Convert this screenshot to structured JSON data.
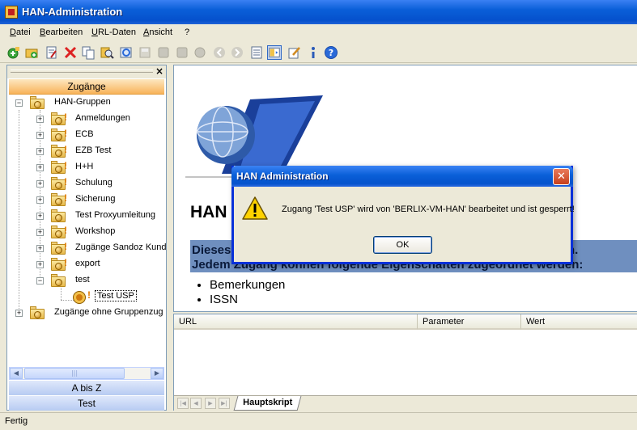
{
  "window": {
    "title": "HAN-Administration"
  },
  "menu": [
    "Datei",
    "Bearbeiten",
    "URL-Daten",
    "Ansicht",
    "?"
  ],
  "toolbar_icons": [
    "add-green-icon",
    "add-folder-icon",
    "edit-doc-icon",
    "delete-icon",
    "copy-icon",
    "find-icon",
    "refresh-icon",
    "save-icon",
    "stop-icon",
    "stop2-icon",
    "globe-icon",
    "back-icon",
    "forward-icon",
    "page-icon",
    "view-icon",
    "edit-icon",
    "info-icon",
    "help-icon"
  ],
  "left_panel": {
    "header": "Zugänge",
    "tree": [
      {
        "label": "HAN-Gruppen",
        "level": 0,
        "expanded": true,
        "warning": false
      },
      {
        "label": "Anmeldungen",
        "level": 1,
        "expanded": false,
        "warning": true
      },
      {
        "label": "ECB",
        "level": 1,
        "expanded": false,
        "warning": true
      },
      {
        "label": "EZB Test",
        "level": 1,
        "expanded": false,
        "warning": true
      },
      {
        "label": "H+H",
        "level": 1,
        "expanded": false,
        "warning": true
      },
      {
        "label": "Schulung",
        "level": 1,
        "expanded": false,
        "warning": true
      },
      {
        "label": "Sicherung",
        "level": 1,
        "expanded": false,
        "warning": true
      },
      {
        "label": "Test Proxyumleitung",
        "level": 1,
        "expanded": false,
        "warning": false
      },
      {
        "label": "Workshop",
        "level": 1,
        "expanded": false,
        "warning": true
      },
      {
        "label": "Zugänge Sandoz Kund",
        "level": 1,
        "expanded": false,
        "warning": true
      },
      {
        "label": "export",
        "level": 1,
        "expanded": false,
        "warning": true
      },
      {
        "label": "test",
        "level": 1,
        "expanded": true,
        "warning": false
      },
      {
        "label": "Test USP",
        "level": 2,
        "expanded": null,
        "warning": true,
        "selected": true
      },
      {
        "label": "Zugänge ohne Gruppenzug",
        "level": 0,
        "expanded": false,
        "warning": false
      }
    ],
    "tabs": [
      "A bis Z",
      "Test"
    ]
  },
  "content": {
    "heading": "HAN",
    "highlight_line1": "Dieses",
    "highlight_line1_tail": "n.",
    "highlight_line2": "Jedem Zugang können folgende Eigenschaften zugeordnet werden:",
    "bullets": [
      "Bemerkungen",
      "ISSN"
    ]
  },
  "bottom_panel": {
    "columns": [
      "URL",
      "Parameter",
      "Wert"
    ],
    "sheet_tab": "Hauptskript"
  },
  "status": "Fertig",
  "dialog": {
    "title": "HAN Administration",
    "message": "Zugang 'Test USP' wird von 'BERLIX-VM-HAN' bearbeitet und ist gesperrt!",
    "ok": "OK"
  },
  "colors": {
    "accent": "#0a5fd8",
    "header_orange": "#f8b35a",
    "highlight": "#6f8fbf"
  }
}
